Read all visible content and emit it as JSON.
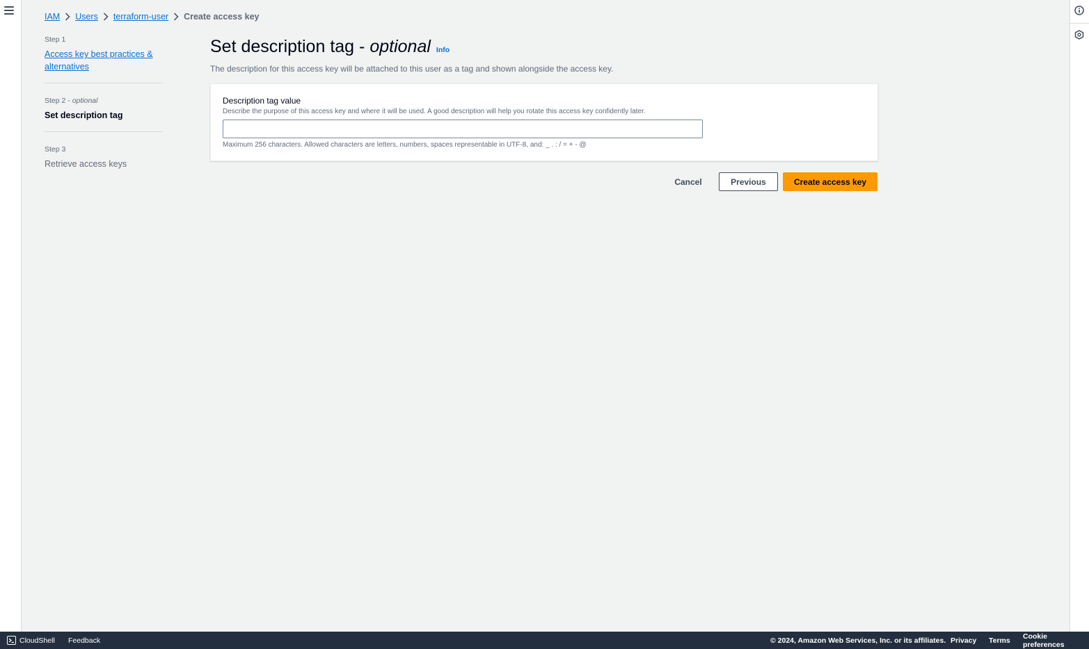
{
  "breadcrumb": {
    "items": [
      "IAM",
      "Users",
      "terraform-user"
    ],
    "current": "Create access key"
  },
  "steps": [
    {
      "number": "Step 1",
      "label": "Access key best practices &",
      "label2": "alternatives"
    },
    {
      "number": "Step 2",
      "optional": "optional",
      "label": "Set description tag"
    },
    {
      "number": "Step 3",
      "label": "Retrieve access keys"
    }
  ],
  "header": {
    "title": "Set description tag -",
    "title_optional": "optional",
    "info": "Info",
    "description": "The description for this access key will be attached to this user as a tag and shown alongside the access key."
  },
  "form": {
    "label": "Description tag value",
    "description": "Describe the purpose of this access key and where it will be used. A good description will help you rotate this access key confidently later.",
    "value": "",
    "constraint": "Maximum 256 characters. Allowed characters are letters, numbers, spaces representable in UTF-8, and: _ . : / = + - @"
  },
  "actions": {
    "cancel": "Cancel",
    "previous": "Previous",
    "create": "Create access key"
  },
  "footer": {
    "cloudshell": "CloudShell",
    "feedback": "Feedback",
    "copyright": "© 2024, Amazon Web Services, Inc. or its affiliates.",
    "privacy": "Privacy",
    "terms": "Terms",
    "cookies": "Cookie preferences"
  },
  "colors": {
    "link": "#0972d3",
    "primary_button": "#ff9900",
    "footer_bg": "#232f3e",
    "page_bg": "#f1f2f2"
  },
  "icons": [
    "menu-icon",
    "info-circle-icon",
    "settings-hex-icon",
    "chevron-right-icon",
    "terminal-icon"
  ]
}
